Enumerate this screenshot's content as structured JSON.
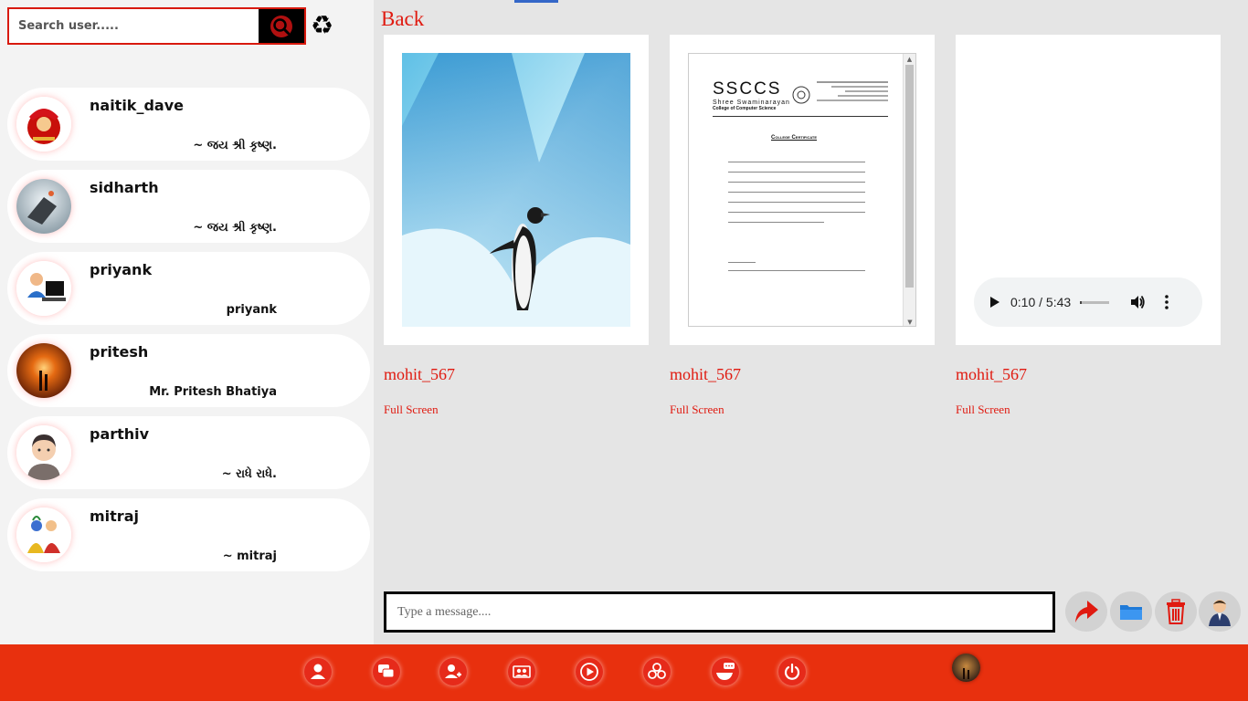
{
  "search": {
    "placeholder": "Search user.....",
    "search_icon": "search-icon",
    "refresh_icon": "recycle-icon"
  },
  "users": [
    {
      "name": "naitik_dave",
      "status": "~ જય શ્રી કૃષ્ણ.",
      "avatar": "cartoon-avatar"
    },
    {
      "name": "sidharth",
      "status": "~ જય શ્રી કૃષ્ણ.",
      "avatar": "laptop-avatar"
    },
    {
      "name": "priyank",
      "status": "priyank",
      "avatar": "computer-user-avatar"
    },
    {
      "name": "pritesh",
      "status": "Mr. Pritesh Bhatiya",
      "avatar": "sunset-avatar"
    },
    {
      "name": "parthiv",
      "status": "~ રાધે રાધે.",
      "avatar": "emoji-man-avatar"
    },
    {
      "name": "mitraj",
      "status": "~ mitraj",
      "avatar": "krishna-avatar"
    }
  ],
  "main": {
    "back_label": "Back",
    "media": [
      {
        "owner": "mohit_567",
        "fullscreen_label": "Full Screen",
        "type": "image"
      },
      {
        "owner": "mohit_567",
        "fullscreen_label": "Full Screen",
        "type": "document"
      },
      {
        "owner": "mohit_567",
        "fullscreen_label": "Full Screen",
        "type": "audio"
      }
    ],
    "audio": {
      "time": "0:10 / 5:43",
      "progress": 0.03
    },
    "document": {
      "college_short": "SSCCS",
      "college_line1": "Shree Swaminarayan",
      "college_line2": "College of Computer Science",
      "cert_title": "College Certificate"
    }
  },
  "composer": {
    "placeholder": "Type a message....",
    "send_icon": "send-arrow-icon",
    "attach_icon": "folder-icon",
    "delete_icon": "trash-icon",
    "profile_icon": "user-profile-icon"
  },
  "bottom_nav": [
    "profile-icon",
    "chat-icon",
    "user-add-icon",
    "group-icon",
    "video-icon",
    "circle-icon",
    "notification-icon",
    "power-icon",
    "avatar"
  ],
  "colors": {
    "accent": "#e01a10",
    "bottom_bar": "#e8300e",
    "sidebar_bg": "#f3f3f3",
    "main_bg": "#e5e5e5"
  }
}
